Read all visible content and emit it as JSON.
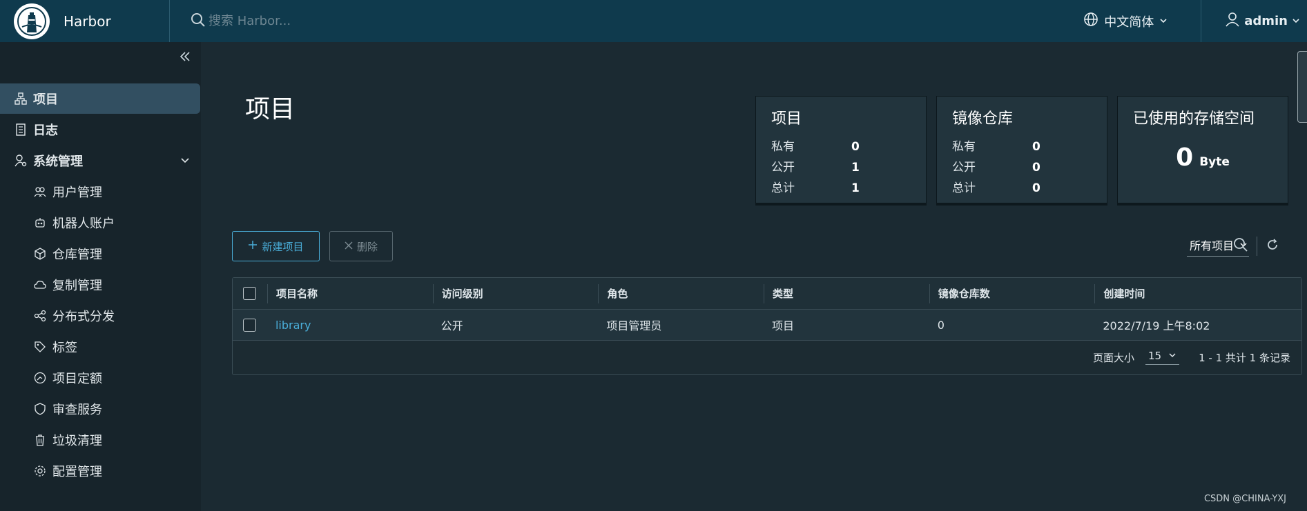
{
  "header": {
    "brand": "Harbor",
    "search_placeholder": "搜索 Harbor...",
    "language": "中文简体",
    "user": "admin"
  },
  "sidebar": {
    "items": [
      {
        "label": "项目",
        "icon": "project-icon"
      },
      {
        "label": "日志",
        "icon": "log-icon"
      },
      {
        "label": "系统管理",
        "icon": "admin-icon"
      },
      {
        "label": "用户管理",
        "icon": "users-icon"
      },
      {
        "label": "机器人账户",
        "icon": "robot-icon"
      },
      {
        "label": "仓库管理",
        "icon": "registry-icon"
      },
      {
        "label": "复制管理",
        "icon": "replication-icon"
      },
      {
        "label": "分布式分发",
        "icon": "distribution-icon"
      },
      {
        "label": "标签",
        "icon": "tag-icon"
      },
      {
        "label": "项目定额",
        "icon": "quota-icon"
      },
      {
        "label": "审查服务",
        "icon": "shield-icon"
      },
      {
        "label": "垃圾清理",
        "icon": "trash-icon"
      },
      {
        "label": "配置管理",
        "icon": "gear-icon"
      }
    ]
  },
  "main": {
    "title": "项目",
    "cards": {
      "projects": {
        "title": "项目",
        "private_label": "私有",
        "private": "0",
        "public_label": "公开",
        "public": "1",
        "total_label": "总计",
        "total": "1"
      },
      "repos": {
        "title": "镜像仓库",
        "private_label": "私有",
        "private": "0",
        "public_label": "公开",
        "public": "0",
        "total_label": "总计",
        "total": "0"
      },
      "storage": {
        "title": "已使用的存储空间",
        "value": "0",
        "unit": "Byte"
      }
    },
    "buttons": {
      "new_project": "新建项目",
      "delete": "删除"
    },
    "filter": "所有项目",
    "table": {
      "headers": [
        "项目名称",
        "访问级别",
        "角色",
        "类型",
        "镜像仓库数",
        "创建时间"
      ],
      "rows": [
        {
          "name": "library",
          "access": "公开",
          "role": "项目管理员",
          "type": "项目",
          "repo_count": "0",
          "created": "2022/7/19 上午8:02"
        }
      ],
      "page_size_label": "页面大小",
      "page_size": "15",
      "summary": "1 - 1 共计 1 条记录"
    }
  },
  "watermark": "CSDN @CHINA-YXJ",
  "colors": {
    "header_bg": "#0f3a4d",
    "accent": "#4aaed9",
    "page_bg": "#1b2a32"
  }
}
